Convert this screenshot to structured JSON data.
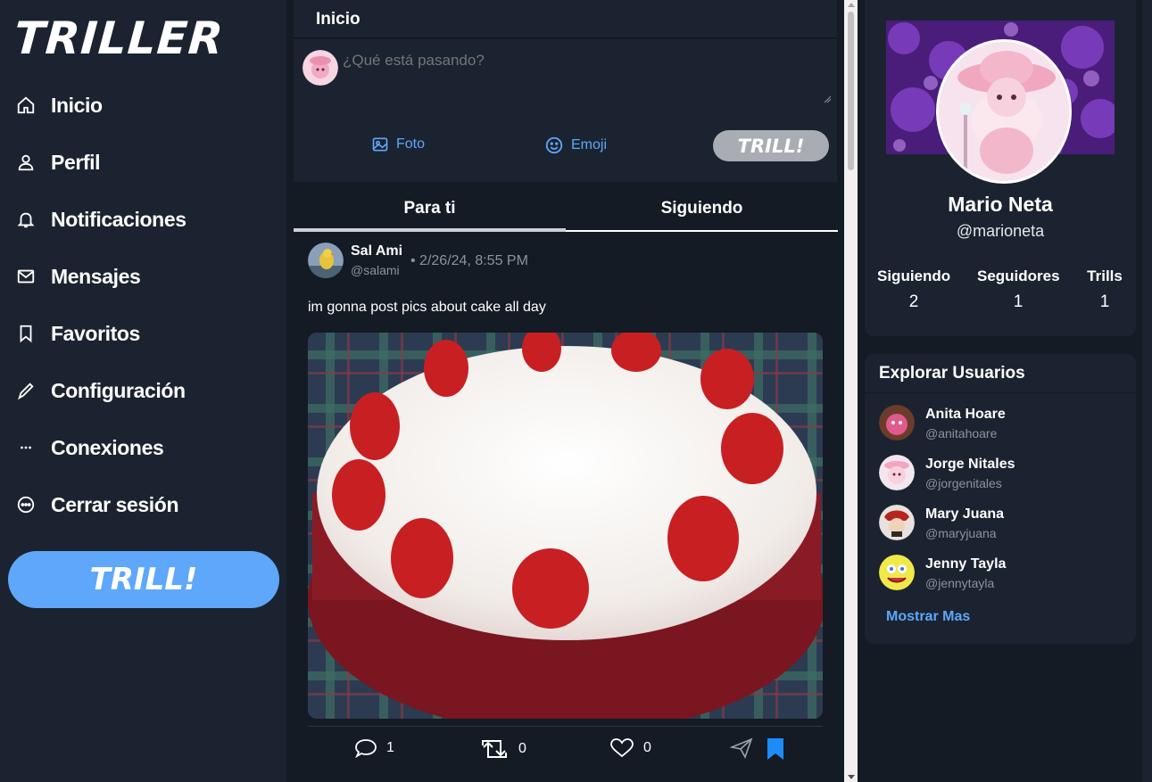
{
  "app": {
    "logo": "TRILLER"
  },
  "sidebar": {
    "items": [
      {
        "label": "Inicio",
        "icon": "home-icon"
      },
      {
        "label": "Perfil",
        "icon": "user-icon"
      },
      {
        "label": "Notificaciones",
        "icon": "bell-icon"
      },
      {
        "label": "Mensajes",
        "icon": "mail-icon"
      },
      {
        "label": "Favoritos",
        "icon": "bookmark-icon"
      },
      {
        "label": "Configuración",
        "icon": "pen-icon"
      },
      {
        "label": "Conexiones",
        "icon": "dots-icon"
      },
      {
        "label": "Cerrar sesión",
        "icon": "logout-circle-icon"
      }
    ],
    "trill_button": "TRILL!"
  },
  "main": {
    "header_title": "Inicio",
    "composer": {
      "placeholder": "¿Qué está pasando?",
      "photo_label": "Foto",
      "emoji_label": "Emoji",
      "submit_label": "TRILL!"
    },
    "tabs": [
      {
        "label": "Para ti"
      },
      {
        "label": "Siguiendo"
      }
    ],
    "post": {
      "author_name": "Sal Ami",
      "author_handle": "@salami",
      "date": "• 2/26/24, 8:55 PM",
      "text": "im gonna post pics about cake all day",
      "comments": "1",
      "retrills": "0",
      "likes": "0"
    }
  },
  "profile": {
    "name": "Mario Neta",
    "handle": "@marioneta",
    "stats": [
      {
        "label": "Siguiendo",
        "value": "2"
      },
      {
        "label": "Seguidores",
        "value": "1"
      },
      {
        "label": "Trills",
        "value": "1"
      }
    ]
  },
  "explore": {
    "title": "Explorar Usuarios",
    "users": [
      {
        "name": "Anita Hoare",
        "handle": "@anitahoare"
      },
      {
        "name": "Jorge Nitales",
        "handle": "@jorgenitales"
      },
      {
        "name": "Mary Juana",
        "handle": "@maryjuana"
      },
      {
        "name": "Jenny Tayla",
        "handle": "@jennytayla"
      }
    ],
    "more_label": "Mostrar Mas"
  },
  "colors": {
    "accent": "#5ea7fb",
    "background": "#1b2330",
    "feed_bg": "#141b25",
    "bookmark": "#1d8cf8"
  }
}
